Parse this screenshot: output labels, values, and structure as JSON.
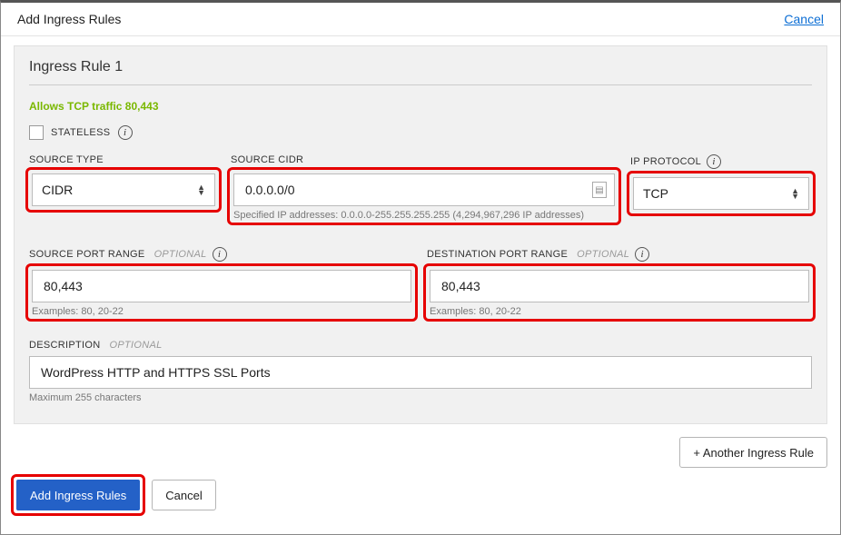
{
  "header": {
    "title": "Add Ingress Rules",
    "cancel": "Cancel"
  },
  "rule": {
    "title": "Ingress Rule 1",
    "allows": "Allows TCP traffic 80,443",
    "stateless_label": "STATELESS",
    "source_type": {
      "label": "SOURCE TYPE",
      "value": "CIDR"
    },
    "source_cidr": {
      "label": "SOURCE CIDR",
      "value": "0.0.0.0/0",
      "helper": "Specified IP addresses: 0.0.0.0-255.255.255.255 (4,294,967,296 IP addresses)"
    },
    "ip_protocol": {
      "label": "IP PROTOCOL",
      "value": "TCP"
    },
    "source_port": {
      "label": "SOURCE PORT RANGE",
      "optional": "OPTIONAL",
      "value": "80,443",
      "helper": "Examples: 80, 20-22"
    },
    "dest_port": {
      "label": "DESTINATION PORT RANGE",
      "optional": "OPTIONAL",
      "value": "80,443",
      "helper": "Examples: 80, 20-22"
    },
    "description": {
      "label": "DESCRIPTION",
      "optional": "OPTIONAL",
      "value": "WordPress HTTP and HTTPS SSL Ports",
      "helper": "Maximum 255 characters"
    }
  },
  "footer": {
    "another": "+ Another Ingress Rule",
    "submit": "Add Ingress Rules",
    "cancel": "Cancel"
  }
}
